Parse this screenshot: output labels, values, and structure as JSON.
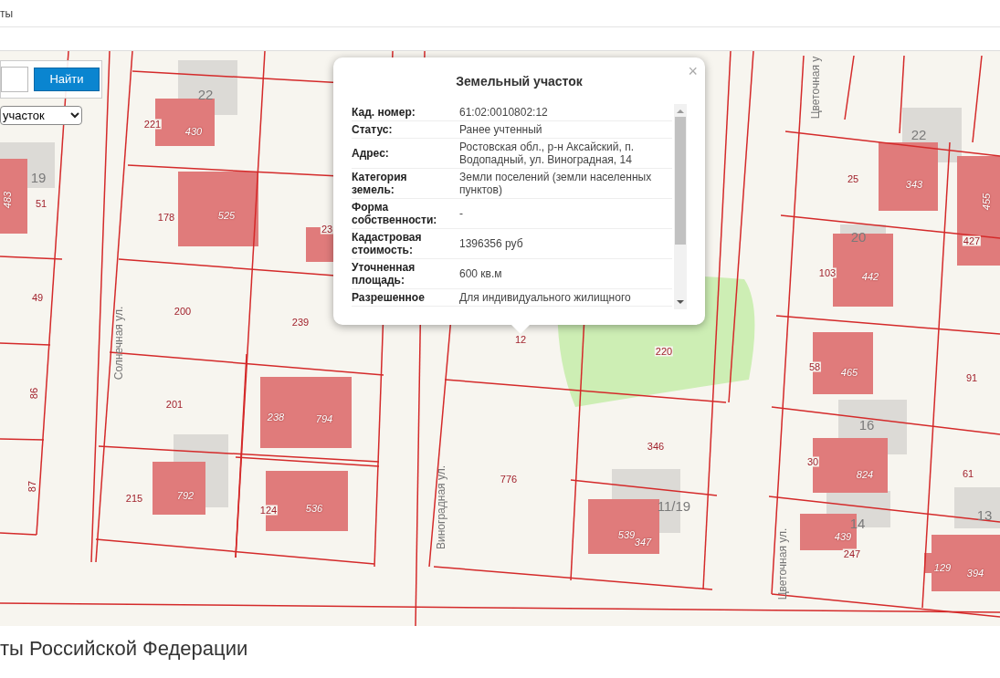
{
  "header": {
    "text": "ты"
  },
  "search": {
    "button": "Найти",
    "select_value": "участок"
  },
  "popup": {
    "title": "Земельный участок",
    "close": "×",
    "rows": [
      {
        "label": "Кад. номер:",
        "value": "61:02:0010802:12"
      },
      {
        "label": "Статус:",
        "value": "Ранее учтенный"
      },
      {
        "label": "Адрес:",
        "value": "Ростовская обл., р-н Аксайский, п. Водопадный, ул. Виноградная, 14"
      },
      {
        "label": "Категория земель:",
        "value": "Земли поселений (земли населенных пунктов)"
      },
      {
        "label": "Форма собственности:",
        "value": "-"
      },
      {
        "label": "Кадастровая стоимость:",
        "value": "1396356 руб"
      },
      {
        "label": "Уточненная площадь:",
        "value": "600 кв.м"
      },
      {
        "label": "Разрешенное",
        "value": "Для индивидуального жилищного"
      }
    ]
  },
  "map_labels": [
    {
      "kind": "house",
      "text": "22"
    },
    {
      "kind": "house",
      "text": "19"
    },
    {
      "kind": "house",
      "text": "22"
    },
    {
      "kind": "house",
      "text": "20"
    },
    {
      "kind": "house",
      "text": "16"
    },
    {
      "kind": "house",
      "text": "14"
    },
    {
      "kind": "house",
      "text": "13"
    },
    {
      "kind": "house",
      "text": "11/19"
    },
    {
      "kind": "parcel",
      "text": "221"
    },
    {
      "kind": "parcel",
      "text": "51"
    },
    {
      "kind": "parcel",
      "text": "178"
    },
    {
      "kind": "parcel",
      "text": "49"
    },
    {
      "kind": "parcel",
      "text": "200"
    },
    {
      "kind": "parcel",
      "text": "239"
    },
    {
      "kind": "parcel",
      "text": "86"
    },
    {
      "kind": "parcel",
      "text": "201"
    },
    {
      "kind": "parcel",
      "text": "215"
    },
    {
      "kind": "parcel",
      "text": "124"
    },
    {
      "kind": "parcel",
      "text": "87"
    },
    {
      "kind": "parcel",
      "text": "12"
    },
    {
      "kind": "parcel",
      "text": "220"
    },
    {
      "kind": "parcel",
      "text": "776"
    },
    {
      "kind": "parcel",
      "text": "346"
    },
    {
      "kind": "parcel",
      "text": "25"
    },
    {
      "kind": "parcel",
      "text": "103"
    },
    {
      "kind": "parcel",
      "text": "427"
    },
    {
      "kind": "parcel",
      "text": "58"
    },
    {
      "kind": "parcel",
      "text": "91"
    },
    {
      "kind": "parcel",
      "text": "30"
    },
    {
      "kind": "parcel",
      "text": "61"
    },
    {
      "kind": "parcel",
      "text": "247"
    },
    {
      "kind": "parcel",
      "text": "23"
    },
    {
      "kind": "building",
      "text": "430"
    },
    {
      "kind": "building",
      "text": "483"
    },
    {
      "kind": "building",
      "text": "525"
    },
    {
      "kind": "building",
      "text": "238"
    },
    {
      "kind": "building",
      "text": "794"
    },
    {
      "kind": "building",
      "text": "792"
    },
    {
      "kind": "building",
      "text": "536"
    },
    {
      "kind": "building",
      "text": "539"
    },
    {
      "kind": "building",
      "text": "347"
    },
    {
      "kind": "building",
      "text": "343"
    },
    {
      "kind": "building",
      "text": "455"
    },
    {
      "kind": "building",
      "text": "442"
    },
    {
      "kind": "building",
      "text": "465"
    },
    {
      "kind": "building",
      "text": "824"
    },
    {
      "kind": "building",
      "text": "439"
    },
    {
      "kind": "building",
      "text": "129"
    },
    {
      "kind": "building",
      "text": "394"
    },
    {
      "kind": "street",
      "text": "Солнечная ул."
    },
    {
      "kind": "street",
      "text": "Виноградная ул."
    },
    {
      "kind": "street",
      "text": "Цветочная ул."
    },
    {
      "kind": "street",
      "text": "Цветочная у"
    }
  ],
  "footer": {
    "heading": "ты Российской Федерации"
  }
}
